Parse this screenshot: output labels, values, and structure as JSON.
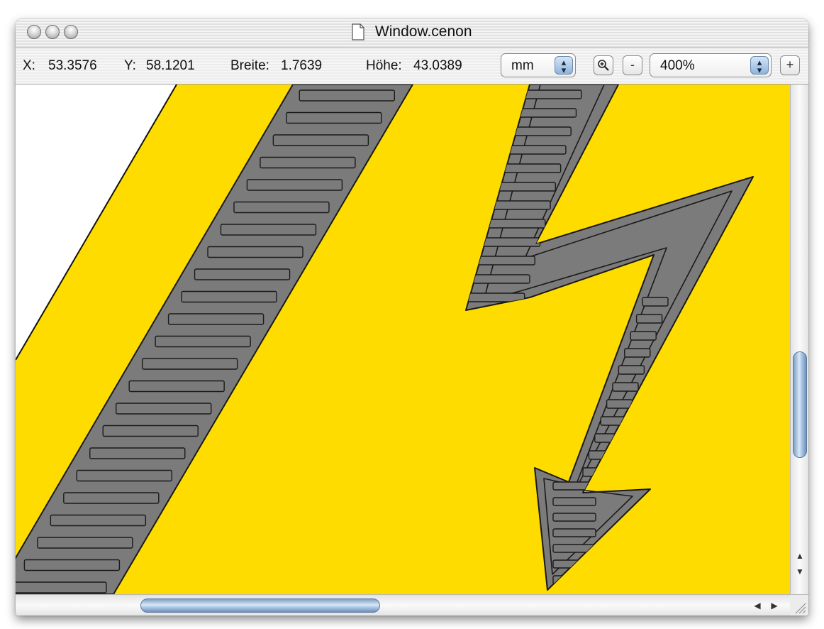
{
  "window": {
    "title": "Window.cenon"
  },
  "toolbar": {
    "x_label": "X:",
    "x_value": "53.3576",
    "y_label": "Y:",
    "y_value": "58.1201",
    "width_label": "Breite:",
    "width_value": "1.7639",
    "height_label": "Höhe:",
    "height_value": "43.0389",
    "unit": "mm",
    "zoom_in_icon": "magnifier-plus-icon",
    "zoom_minus": "-",
    "zoom_level": "400%",
    "zoom_plus": "+"
  },
  "canvas": {
    "colors": {
      "yellow": "#ffdc00",
      "gray": "#7b7b7b",
      "outline": "#1a1a1a"
    }
  },
  "scroll": {
    "vertical_position": 0.55,
    "horizontal_position": 0.28
  }
}
